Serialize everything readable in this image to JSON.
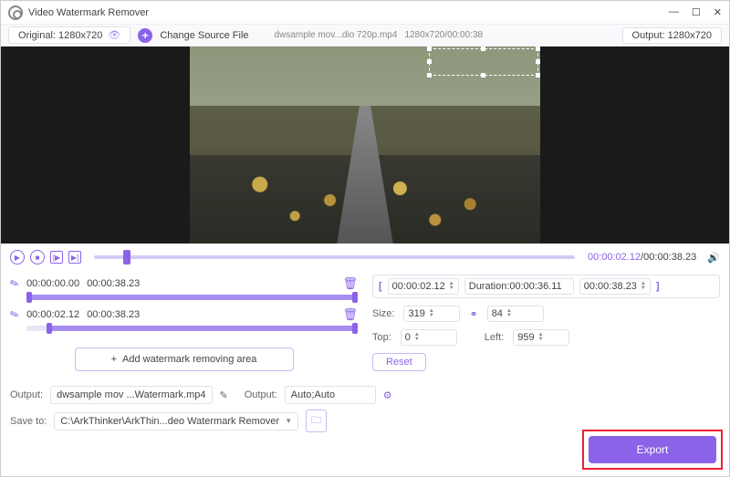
{
  "title": "Video Watermark Remover",
  "toolbar": {
    "original_label": "Original: 1280x720",
    "change_source": "Change Source File",
    "filename": "dwsample mov...dio 720p.mp4",
    "meta": "1280x720/00:00:38",
    "output_label": "Output: 1280x720"
  },
  "playback": {
    "current": "00:00:02.12",
    "total": "00:00:38.23"
  },
  "segments": [
    {
      "start": "00:00:00.00",
      "end": "00:00:38.23",
      "fill": 100,
      "h1": 0,
      "h2": 100
    },
    {
      "start": "00:00:02.12",
      "end": "00:00:38.23",
      "fill": 94,
      "h1": 6,
      "h2": 100
    }
  ],
  "add_area": "Add watermark removing area",
  "range": {
    "start": "00:00:02.12",
    "duration_label": "Duration:00:00:36.11",
    "end": "00:00:38.23"
  },
  "props": {
    "size_label": "Size:",
    "w": "319",
    "h": "84",
    "top_label": "Top:",
    "top": "0",
    "left_label": "Left:",
    "left": "959"
  },
  "reset": "Reset",
  "out": {
    "label": "Output:",
    "fname": "dwsample mov ...Watermark.mp4",
    "fmt_label": "Output:",
    "fmt": "Auto;Auto",
    "save_label": "Save to:",
    "path": "C:\\ArkThinker\\ArkThin...deo Watermark Remover"
  },
  "export": "Export"
}
